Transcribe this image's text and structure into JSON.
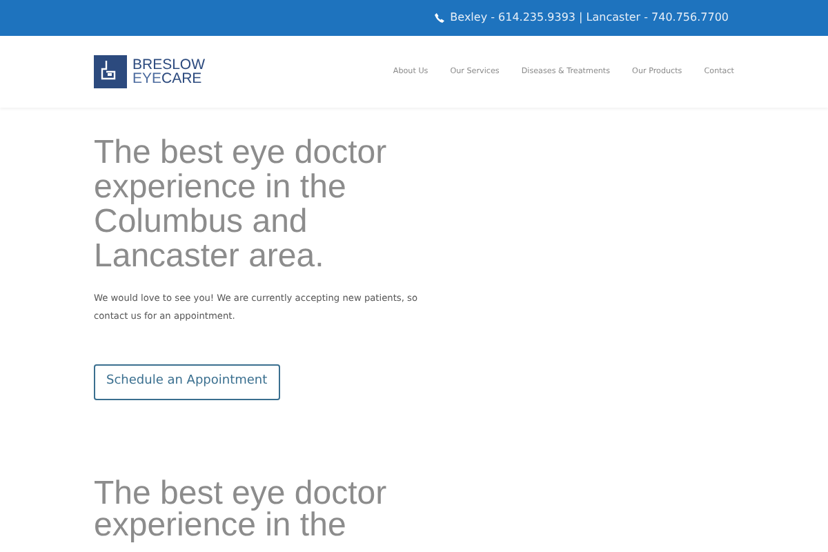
{
  "top_bar": {
    "phone_text": "Bexley - 614.235.9393 | Lancaster - 740.756.7700"
  },
  "logo": {
    "line_1": "BRESLOW",
    "line_2_a": "EYE",
    "line_2_b": "CARE"
  },
  "nav": [
    {
      "label": "About Us"
    },
    {
      "label": "Our Services"
    },
    {
      "label": "Diseases & Treatments"
    },
    {
      "label": "Our Products"
    },
    {
      "label": "Contact"
    }
  ],
  "hero": {
    "heading": "The best eye doctor experience in the Columbus and Lancaster area.",
    "text": "We would love to see you! We are currently accepting new patients, so contact us for an appointment.",
    "button": "Schedule an Appointment"
  },
  "section_2": {
    "heading": "The best eye doctor experience in the"
  }
}
